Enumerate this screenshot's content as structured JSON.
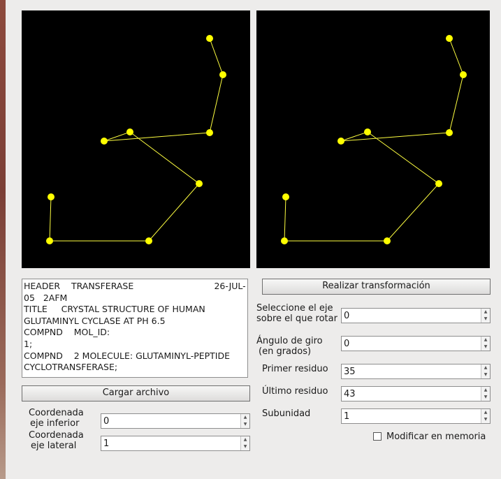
{
  "pdb_header_text": "HEADER    TRANSFERASE                             26-JUL-05   2AFM\nTITLE     CRYSTAL STRUCTURE OF HUMAN GLUTAMINYL CYCLASE AT PH 6.5\nCOMPND    MOL_ID:\n1;\nCOMPND    2 MOLECULE: GLUTAMINYL-PEPTIDE CYCLOTRANSFERASE;",
  "left_panel": {
    "load_button": "Cargar archivo",
    "coord_bottom_label_1": "Coordenada",
    "coord_bottom_label_2": "eje inferior",
    "coord_bottom_value": "0",
    "coord_lateral_label_1": "Coordenada",
    "coord_lateral_label_2": "eje lateral",
    "coord_lateral_value": "1"
  },
  "right_panel": {
    "transform_button": "Realizar transformación",
    "axis_label_1": "Seleccione el eje",
    "axis_label_2": "sobre el que rotar",
    "axis_value": "0",
    "angle_label_1": "Ángulo de giro",
    "angle_label_2": "(en grados)",
    "angle_value": "0",
    "first_residue_label": "Primer residuo",
    "first_residue_value": "35",
    "last_residue_label": "Último residuo",
    "last_residue_value": "43",
    "subunit_label": "Subunidad",
    "subunit_value": "1",
    "memory_checkbox_label": "Modificar en memoria",
    "memory_checkbox_checked": false
  },
  "colors": {
    "atom": "#ffff00",
    "bond": "#ffff40",
    "canvas_bg": "#000000"
  }
}
